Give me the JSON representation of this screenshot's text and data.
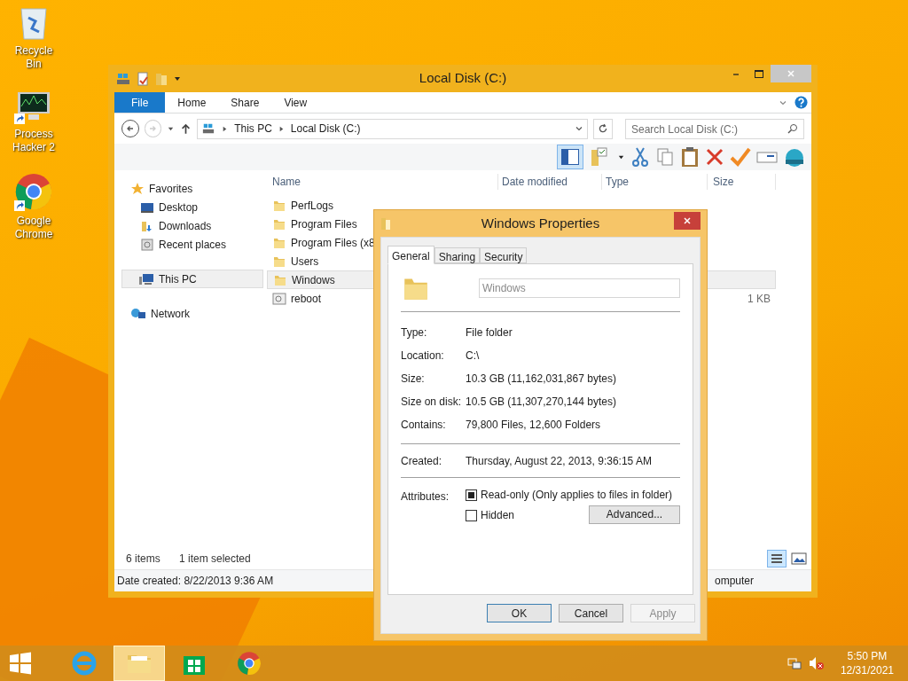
{
  "desktop_icons": [
    {
      "label": "Recycle Bin",
      "kind": "recycle",
      "shortcut": false
    },
    {
      "label": "Process Hacker 2",
      "kind": "monitor",
      "shortcut": true
    },
    {
      "label": "Google Chrome",
      "kind": "chrome",
      "shortcut": true
    }
  ],
  "explorer": {
    "title": "Local Disk (C:)",
    "ribbon_tabs": [
      {
        "label": "File",
        "kind": "file",
        "selected": false
      },
      {
        "label": "Home",
        "kind": "tab",
        "selected": false
      },
      {
        "label": "Share",
        "kind": "tab",
        "selected": false
      },
      {
        "label": "View",
        "kind": "tab",
        "selected": false
      }
    ],
    "breadcrumbs": [
      "This PC",
      "Local Disk (C:)"
    ],
    "search": {
      "placeholder": "Search Local Disk (C:)"
    },
    "columns": [
      "Name",
      "Date modified",
      "Type",
      "Size"
    ],
    "nav": [
      {
        "label": "Favorites",
        "kind": "star",
        "selected": false,
        "children": [
          {
            "label": "Desktop",
            "kind": "desktop",
            "selected": false
          },
          {
            "label": "Downloads",
            "kind": "download",
            "selected": false
          },
          {
            "label": "Recent places",
            "kind": "recent",
            "selected": false
          }
        ]
      },
      {
        "label": "This PC",
        "kind": "pc",
        "selected": true
      },
      {
        "label": "Network",
        "kind": "network",
        "selected": false
      }
    ],
    "rows": [
      {
        "name": "PerfLogs",
        "kind": "folder",
        "selected": false
      },
      {
        "name": "Program Files",
        "kind": "folder",
        "selected": false
      },
      {
        "name": "Program Files (x8",
        "kind": "folder",
        "selected": false
      },
      {
        "name": "Users",
        "kind": "folder",
        "selected": false
      },
      {
        "name": "Windows",
        "kind": "folder",
        "selected": true
      },
      {
        "name": "reboot",
        "kind": "script",
        "selected": false,
        "size": "1 KB"
      }
    ],
    "status": {
      "count": "6 items",
      "selection": "1 item selected"
    },
    "details_bar": {
      "left": "Date created: 8/22/2013 9:36 AM",
      "right": "omputer"
    }
  },
  "properties": {
    "title": "Windows Properties",
    "tabs": [
      {
        "label": "General",
        "selected": true
      },
      {
        "label": "Sharing",
        "selected": false
      },
      {
        "label": "Security",
        "selected": false
      }
    ],
    "name_field": {
      "value": "Windows",
      "disabled": true
    },
    "info": [
      {
        "label": "Type:",
        "value": "File folder"
      },
      {
        "label": "Location:",
        "value": "C:\\"
      },
      {
        "label": "Size:",
        "value": "10.3 GB (11,162,031,867 bytes)"
      },
      {
        "label": "Size on disk:",
        "value": "10.5 GB (11,307,270,144 bytes)"
      },
      {
        "label": "Contains:",
        "value": "79,800 Files, 12,600 Folders"
      }
    ],
    "created": {
      "label": "Created:",
      "value": "Thursday, August 22, 2013, 9:36:15 AM"
    },
    "attributes": {
      "label": "Attributes:",
      "options": [
        {
          "label": "Read-only (Only applies to files in folder)",
          "checked": false,
          "indeterminate": true
        },
        {
          "label": "Hidden",
          "checked": false,
          "indeterminate": false
        }
      ],
      "advanced": "Advanced..."
    },
    "buttons": [
      {
        "label": "OK",
        "default": true,
        "disabled": false
      },
      {
        "label": "Cancel",
        "default": false,
        "disabled": false
      },
      {
        "label": "Apply",
        "default": false,
        "disabled": true
      }
    ]
  },
  "taskbar": {
    "apps": [
      {
        "kind": "ie",
        "selected": false
      },
      {
        "kind": "explorer",
        "selected": true
      },
      {
        "kind": "store",
        "selected": false
      },
      {
        "kind": "chrome",
        "selected": false
      }
    ],
    "time": "5:50 PM",
    "date": "12/31/2021"
  }
}
